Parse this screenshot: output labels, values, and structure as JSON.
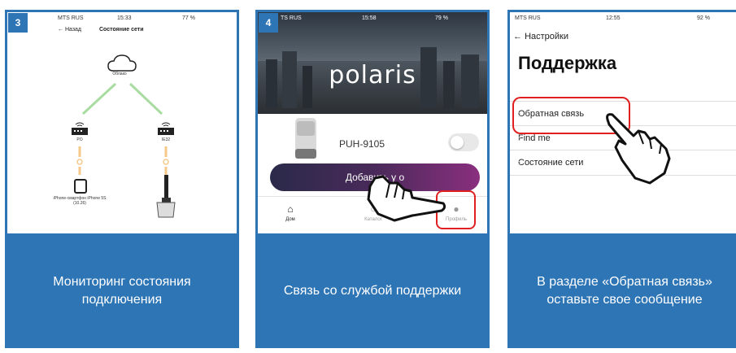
{
  "cards": [
    {
      "number": "3",
      "caption": "Мониторинг состояния подключения",
      "screen": {
        "status_left": "MTS RUS",
        "status_time": "15:33",
        "status_right": "77 %",
        "back_label": "← Назад",
        "title": "Состояние сети",
        "cloud_label": "Облако",
        "node_left_label": "PO",
        "node_right_label": "IE32",
        "device_left_label": "iPhone-смартфон iPhone 5S (10.26)"
      }
    },
    {
      "number": "4",
      "caption": "Связь со службой поддержки",
      "screen": {
        "status_left": "TS RUS",
        "status_time": "15:58",
        "status_right": "79 %",
        "brand": "polaris",
        "product_name": "PUH-9105",
        "add_button": "Добавить у    о",
        "tab_home": "Дом",
        "tab_catalog": "Каталог",
        "tab_profile": "Профиль"
      }
    },
    {
      "number": "",
      "caption": "В разделе «Обратная связь» оставьте свое сообщение",
      "screen": {
        "status_left": "MTS RUS",
        "status_time": "12:55",
        "status_right": "92 %",
        "back_label": "Настройки",
        "title": "Поддержка",
        "rows": [
          "Обратная связь",
          "Find me",
          "Состояние сети"
        ]
      }
    }
  ],
  "colors": {
    "card_blue": "#2e75b6",
    "highlight_red": "#e02020",
    "link_green": "#a8dca0",
    "link_orange": "#f5c98a"
  }
}
